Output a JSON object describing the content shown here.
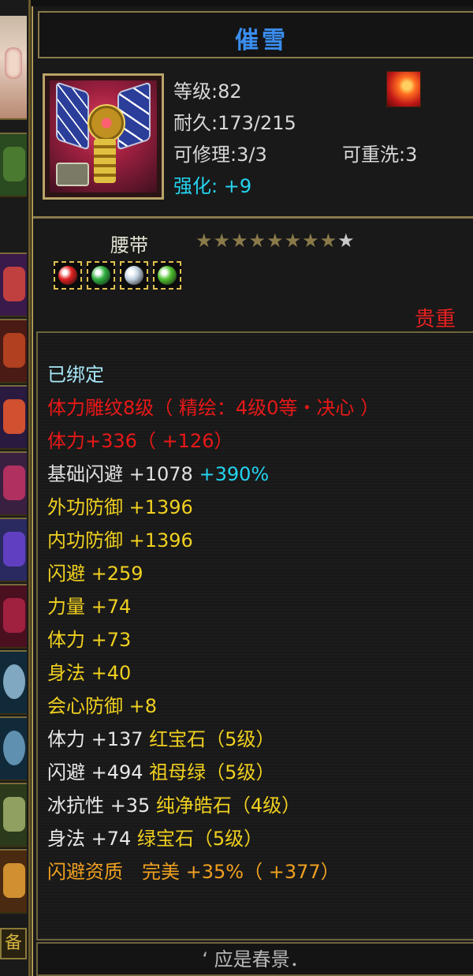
{
  "item": {
    "name": "催雪",
    "level_text": "等级:82",
    "durability_text": "耐久:173/215",
    "repair_text": "可修理:3/3",
    "rewash_text": "可重洗:3",
    "refine_label": "强化:",
    "refine_value": "+9",
    "type_label": "腰带",
    "stars": {
      "filled": 8,
      "total": 9
    },
    "rarity": "贵重",
    "gems": [
      "ruby-gem-icon",
      "emerald-gem-icon",
      "pure-white-stone-icon",
      "green-gem-icon"
    ]
  },
  "stats": [
    {
      "segments": [
        {
          "text": "已绑定",
          "color": "#a8e8f8"
        }
      ]
    },
    {
      "segments": [
        {
          "text": "体力雕纹8级（ 精绘：4级0等・决心 ）",
          "color": "#e81818"
        }
      ]
    },
    {
      "segments": [
        {
          "text": "体力+336（ +126）",
          "color": "#e81818"
        }
      ]
    },
    {
      "segments": [
        {
          "text": "基础闪避 +1078 ",
          "color": "#e0e0e0"
        },
        {
          "text": "+390%",
          "color": "#24d4f0"
        }
      ]
    },
    {
      "segments": [
        {
          "text": "外功防御 +1396",
          "color": "#f0d020"
        }
      ]
    },
    {
      "segments": [
        {
          "text": "内功防御 +1396",
          "color": "#f0d020"
        }
      ]
    },
    {
      "segments": [
        {
          "text": "闪避 +259",
          "color": "#f0d020"
        }
      ]
    },
    {
      "segments": [
        {
          "text": "力量 +74",
          "color": "#f0d020"
        }
      ]
    },
    {
      "segments": [
        {
          "text": "体力 +73",
          "color": "#f0d020"
        }
      ]
    },
    {
      "segments": [
        {
          "text": "身法 +40",
          "color": "#f0d020"
        }
      ]
    },
    {
      "segments": [
        {
          "text": "会心防御 +8",
          "color": "#f0d020"
        }
      ]
    },
    {
      "segments": [
        {
          "text": "体力 +137 ",
          "color": "#e8e8e8"
        },
        {
          "text": "红宝石（5级）",
          "color": "#f0d020"
        }
      ]
    },
    {
      "segments": [
        {
          "text": "闪避 +494 ",
          "color": "#e8e8e8"
        },
        {
          "text": "祖母绿（5级）",
          "color": "#f0d020"
        }
      ]
    },
    {
      "segments": [
        {
          "text": "冰抗性 +35 ",
          "color": "#e8e8e8"
        },
        {
          "text": "纯净皓石（4级）",
          "color": "#f0d020"
        }
      ]
    },
    {
      "segments": [
        {
          "text": "身法 +74 ",
          "color": "#e8e8e8"
        },
        {
          "text": "绿宝石（5级）",
          "color": "#f0d020"
        }
      ]
    },
    {
      "segments": [
        {
          "text": "闪避资质",
          "color": "#f0a020"
        },
        {
          "text": "　完美 ",
          "color": "#f0a020"
        },
        {
          "text": "+35%（ +377）",
          "color": "#f0a020"
        }
      ]
    }
  ],
  "footer_text": "‘ 应是春景．",
  "strip": {
    "bottom_label": "备"
  },
  "colors": {
    "title": "#3a8ef0",
    "rarity": "#e82020",
    "frame": "#8a7a4a",
    "refine": "#24d4f0"
  }
}
